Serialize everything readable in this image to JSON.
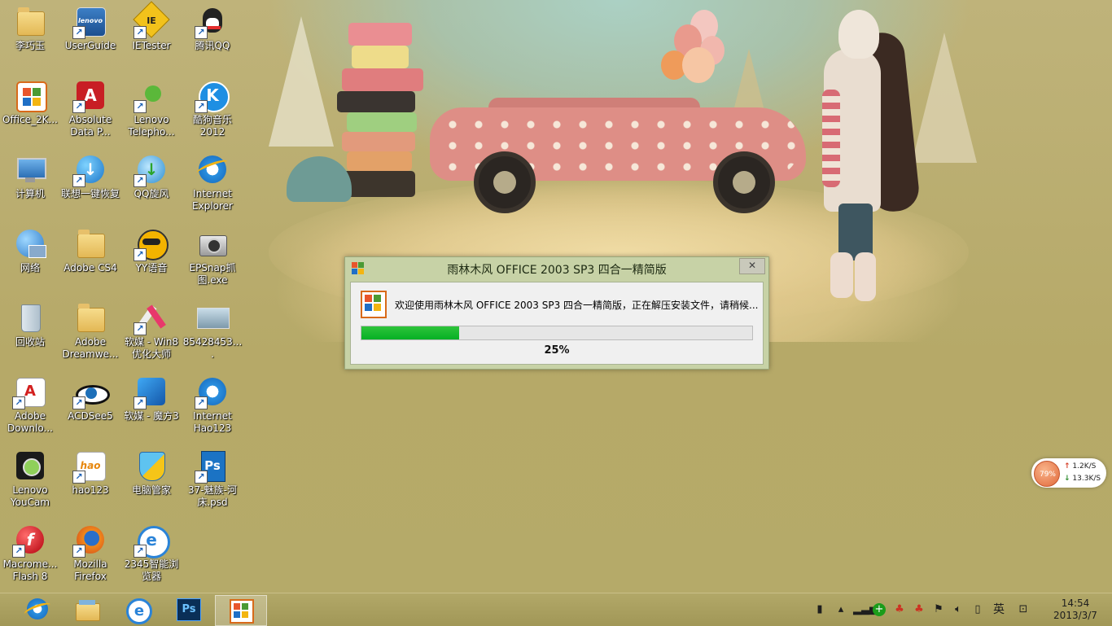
{
  "desktop": {
    "icons": [
      {
        "label": "李巧玉",
        "icon": "user-folder-icon"
      },
      {
        "label": "UserGuide",
        "icon": "lenovo-guide-icon"
      },
      {
        "label": "IETester",
        "icon": "ietester-icon"
      },
      {
        "label": "腾讯QQ",
        "icon": "qq-icon"
      },
      {
        "label": "Office_2K...",
        "icon": "office-installer-icon"
      },
      {
        "label": "Absolute Data P...",
        "icon": "absolute-data-icon"
      },
      {
        "label": "Lenovo Telepho...",
        "icon": "lenovo-telephony-icon"
      },
      {
        "label": "酷狗音乐 2012",
        "icon": "kugou-music-icon"
      },
      {
        "label": "计算机",
        "icon": "computer-icon"
      },
      {
        "label": "联想一键恢复",
        "icon": "lenovo-recovery-icon"
      },
      {
        "label": "QQ旋风",
        "icon": "qq-xuanfeng-icon"
      },
      {
        "label": "Internet Explorer",
        "icon": "ie-icon"
      },
      {
        "label": "网络",
        "icon": "network-icon"
      },
      {
        "label": "Adobe CS4",
        "icon": "folder-icon"
      },
      {
        "label": "YY语音",
        "icon": "yy-voice-icon"
      },
      {
        "label": "EPSnap抓图.exe",
        "icon": "camera-icon"
      },
      {
        "label": "回收站",
        "icon": "recycle-bin-icon"
      },
      {
        "label": "Adobe Dreamwe...",
        "icon": "folder-icon"
      },
      {
        "label": "软媒 - Win8优化大师",
        "icon": "win8-optimizer-icon"
      },
      {
        "label": "85428453....",
        "icon": "image-file-icon"
      },
      {
        "label": "Adobe Downlo...",
        "icon": "adobe-download-icon"
      },
      {
        "label": "ACDSee5",
        "icon": "acdsee-icon"
      },
      {
        "label": "软媒 - 魔方3",
        "icon": "mofang-icon"
      },
      {
        "label": "Internet Hao123",
        "icon": "ie-icon"
      },
      {
        "label": "Lenovo YouCam",
        "icon": "webcam-icon"
      },
      {
        "label": "hao123",
        "icon": "hao123-icon"
      },
      {
        "label": "电脑管家",
        "icon": "pc-manager-icon"
      },
      {
        "label": "37-魅族-河床.psd",
        "icon": "psd-file-icon"
      },
      {
        "label": "Macrome... Flash 8",
        "icon": "flash-icon"
      },
      {
        "label": "Mozilla Firefox",
        "icon": "firefox-icon"
      },
      {
        "label": "2345智能浏览器",
        "icon": "browser-2345-icon"
      }
    ]
  },
  "dialog": {
    "title": "雨林木风 OFFICE 2003 SP3 四合一精简版",
    "close_glyph": "✕",
    "message": "欢迎使用雨林木风 OFFICE 2003 SP3 四合一精简版，正在解压安装文件，请稍候...",
    "progress_value": 0.25,
    "progress_text": "25%"
  },
  "net_widget": {
    "percent": "79%",
    "up_arrow": "↑",
    "up": "1.2K/S",
    "down_arrow": "↓",
    "down": "13.3K/S"
  },
  "taskbar": {
    "buttons": [
      {
        "icon": "ie-icon",
        "active": false
      },
      {
        "icon": "file-explorer-icon",
        "active": false
      },
      {
        "icon": "ie-edge-icon",
        "active": false
      },
      {
        "icon": "photoshop-icon",
        "active": false
      },
      {
        "icon": "office-installer-icon",
        "active": true
      }
    ],
    "ps_label": "Ps",
    "tray": {
      "ime_label": "英",
      "time": "14:54",
      "date": "2013/3/7"
    }
  },
  "colors": {
    "desktop_bg": "#b8ac6c",
    "dialog_frame": "#c7d2a6",
    "progress_green": "#06b025"
  }
}
